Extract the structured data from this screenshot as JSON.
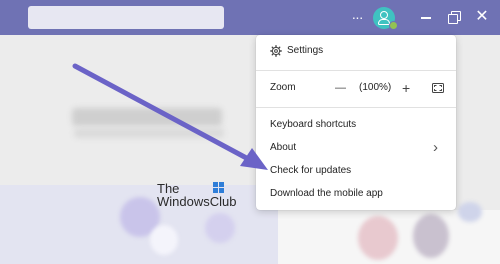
{
  "titlebar": {
    "more_label": "···"
  },
  "menu": {
    "settings_label": "Settings",
    "zoom_label": "Zoom",
    "zoom_minus": "—",
    "zoom_value": "(100%)",
    "zoom_plus": "+",
    "keyboard_shortcuts_label": "Keyboard shortcuts",
    "about_label": "About",
    "about_chevron": "›",
    "check_updates_label": "Check for updates",
    "download_mobile_label": "Download the mobile app"
  },
  "watermark": {
    "line1": "The",
    "line2": "WindowsClub"
  },
  "colors": {
    "titlebar": "#6f72b4",
    "avatar": "#3fc2c1",
    "presence": "#92c353",
    "arrow": "#6b63c7"
  }
}
